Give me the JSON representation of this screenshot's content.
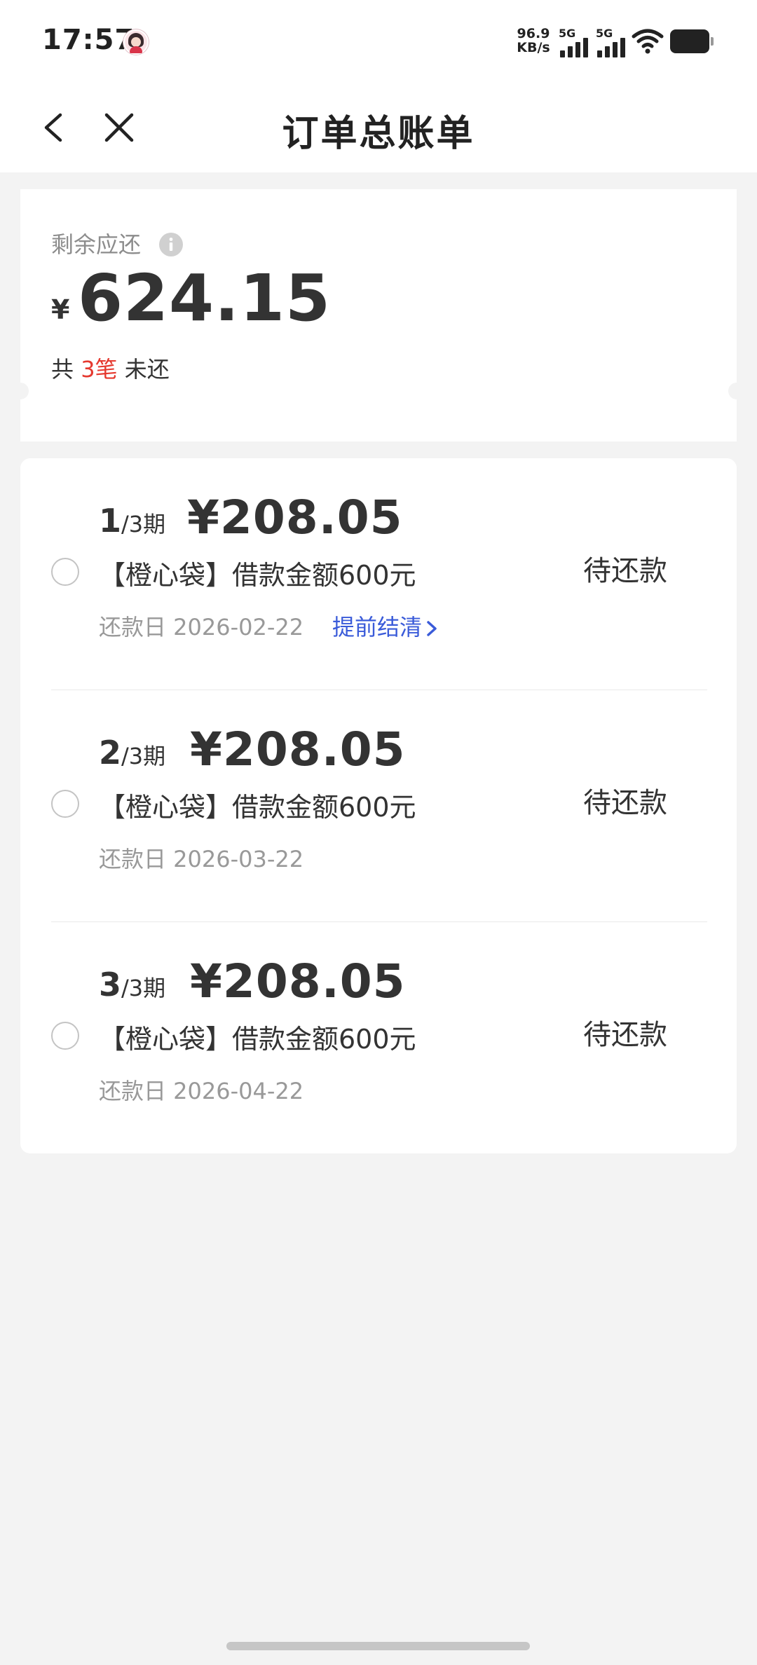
{
  "status_bar": {
    "time": "17:57",
    "net_speed_value": "96.9",
    "net_speed_unit": "KB/s",
    "signal_1_label": "5G",
    "signal_2_label": "5G"
  },
  "nav": {
    "title": "订单总账单",
    "back_icon": "chevron-left-icon",
    "close_icon": "close-icon"
  },
  "summary": {
    "label": "剩余应还",
    "currency": "¥",
    "amount": "624.15",
    "count_prefix": "共",
    "count_value": "3笔",
    "count_suffix": "未还"
  },
  "bills": [
    {
      "period_current": "1",
      "period_total": "/3期",
      "amount": "¥208.05",
      "description": "【橙心袋】借款金额600元",
      "due_date": "还款日 2026-02-22",
      "early_settle": "提前结清",
      "status": "待还款"
    },
    {
      "period_current": "2",
      "period_total": "/3期",
      "amount": "¥208.05",
      "description": "【橙心袋】借款金额600元",
      "due_date": "还款日 2026-03-22",
      "status": "待还款"
    },
    {
      "period_current": "3",
      "period_total": "/3期",
      "amount": "¥208.05",
      "description": "【橙心袋】借款金额600元",
      "due_date": "还款日 2026-04-22",
      "status": "待还款"
    }
  ],
  "colors": {
    "accent_red": "#e5382e",
    "link_blue": "#3a5bd9",
    "background": "#f3f3f3"
  }
}
